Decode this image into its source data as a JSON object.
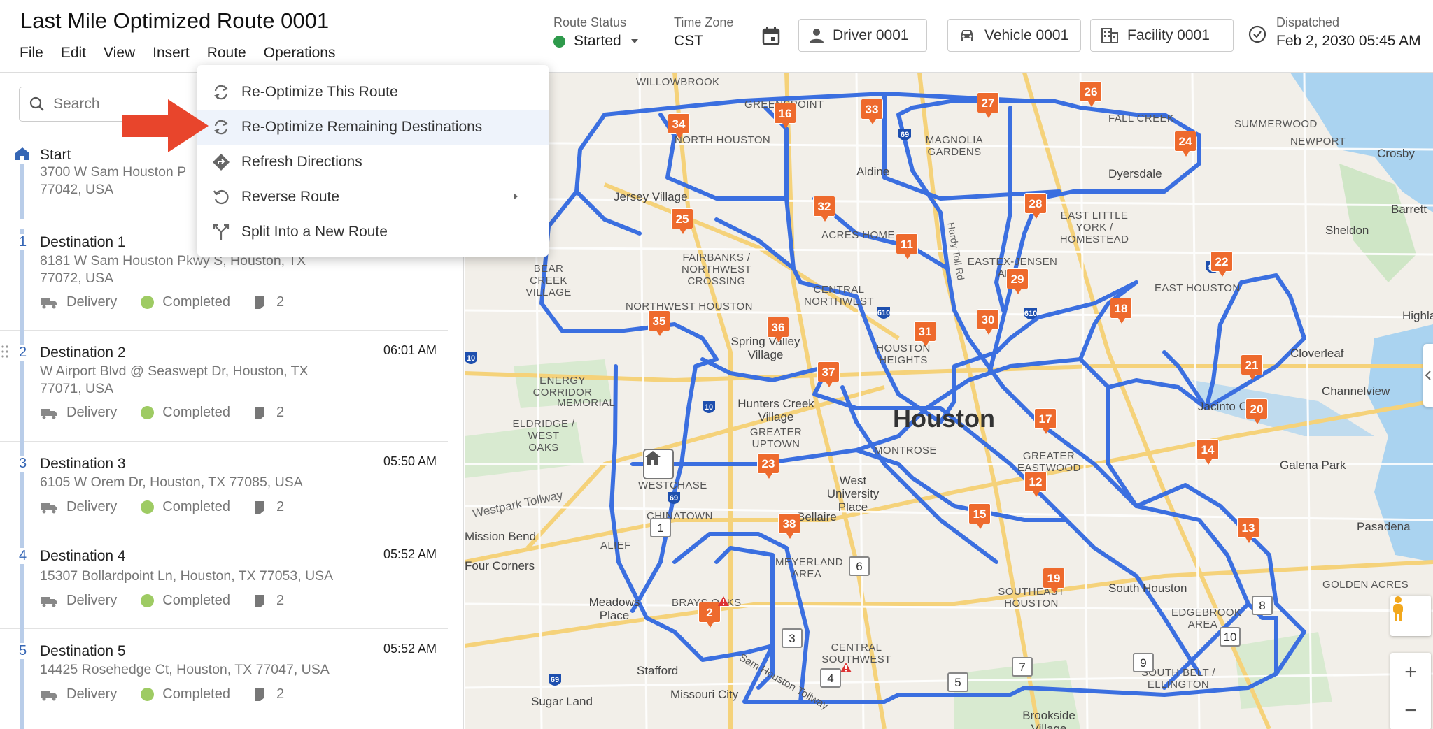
{
  "title": "Last Mile Optimized Route 0001",
  "menu": [
    "File",
    "Edit",
    "View",
    "Insert",
    "Route",
    "Operations"
  ],
  "route_status": {
    "label": "Route Status",
    "value": "Started",
    "color": "#2e9a4b"
  },
  "time_zone": {
    "label": "Time Zone",
    "value": "CST"
  },
  "driver": "Driver 0001",
  "vehicle": "Vehicle 0001",
  "facility": "Facility 0001",
  "dispatched": {
    "label": "Dispatched",
    "value": "Feb 2, 2030 05:45 AM"
  },
  "search": {
    "placeholder": "Search"
  },
  "start": {
    "name": "Start",
    "address_line1": "3700 W Sam Houston P",
    "address_line2": "77042, USA"
  },
  "stops": [
    {
      "num": "1",
      "name": "Destination 1",
      "time": "",
      "address_line1": "8181 W Sam Houston Pkwy S, Houston, TX",
      "address_line2": "77072, USA",
      "type": "Delivery",
      "status": "Completed",
      "count": "2"
    },
    {
      "num": "2",
      "name": "Destination 2",
      "time": "06:01 AM",
      "address_line1": "W Airport Blvd @ Seaswept Dr, Houston, TX",
      "address_line2": "77071, USA",
      "type": "Delivery",
      "status": "Completed",
      "count": "2"
    },
    {
      "num": "3",
      "name": "Destination 3",
      "time": "05:50 AM",
      "address_line1": "6105 W Orem Dr, Houston, TX 77085, USA",
      "address_line2": "",
      "type": "Delivery",
      "status": "Completed",
      "count": "2"
    },
    {
      "num": "4",
      "name": "Destination 4",
      "time": "05:52 AM",
      "address_line1": "15307 Bollardpoint Ln, Houston, TX 77053, USA",
      "address_line2": "",
      "type": "Delivery",
      "status": "Completed",
      "count": "2"
    },
    {
      "num": "5",
      "name": "Destination 5",
      "time": "05:52 AM",
      "address_line1": "14425 Rosehedge Ct, Houston, TX 77047, USA",
      "address_line2": "",
      "type": "Delivery",
      "status": "Completed",
      "count": "2"
    }
  ],
  "route_menu": {
    "items": [
      {
        "label": "Re-Optimize This Route",
        "icon": "refresh-icon"
      },
      {
        "label": "Re-Optimize Remaining Destinations",
        "icon": "refresh-icon",
        "highlighted": true
      },
      {
        "label": "Refresh Directions",
        "icon": "directions-icon"
      },
      {
        "label": "Reverse Route",
        "icon": "reverse-icon",
        "has_submenu": true
      },
      {
        "label": "Split Into a New Route",
        "icon": "split-icon"
      }
    ]
  },
  "map": {
    "city_name": "Houston",
    "route_color": "#3b6fe0",
    "marker_color": "#ee6a2d",
    "areas": [
      "WILLOWBROOK",
      "GREENSPOINT",
      "FALL CREEK",
      "SUMMERWOOD",
      "NORTH HOUSTON",
      "MAGNOLIA GARDENS",
      "NEWPORT",
      "Crosby",
      "Aldine",
      "Dyersdale",
      "Jersey Village",
      "EAST LITTLE YORK / HOMESTEAD",
      "Barrett",
      "Sheldon",
      "FAIRBANKS / NORTHWEST CROSSING",
      "ACRES HOME",
      "BEAR CREEK VILLAGE",
      "EASTEX-JENSEN AREA",
      "CENTRAL NORTHWEST",
      "EAST HOUSTON",
      "NORTHWEST HOUSTON",
      "HOUSTON HEIGHTS",
      "Highlands",
      "Spring Valley Village",
      "Cloverleaf",
      "ENERGY CORRIDOR",
      "MEMORIAL",
      "Channelview",
      "Hunters Creek Village",
      "Jacinto City",
      "ELDRIDGE / WEST OAKS",
      "GREATER UPTOWN",
      "MONTROSE",
      "GREATER EASTWOOD",
      "Galena Park",
      "WESTCHASE",
      "West University Place",
      "Westpark Tollway",
      "CHINATOWN",
      "Bellaire",
      "Pasadena",
      "Mission Bend",
      "ALIEF",
      "Four Corners",
      "MEYERLAND AREA",
      "SOUTHEAST HOUSTON",
      "South Houston",
      "GOLDEN ACRES",
      "Meadows Place",
      "BRAYS OAKS",
      "EDGEBROOK AREA",
      "CENTRAL SOUTHWEST",
      "Stafford",
      "Sam Houston Tollway",
      "Missouri City",
      "Sugar Land",
      "Brookside Village",
      "SOUTH BELT / ELLINGTON",
      "Hardy Toll Rd"
    ]
  }
}
